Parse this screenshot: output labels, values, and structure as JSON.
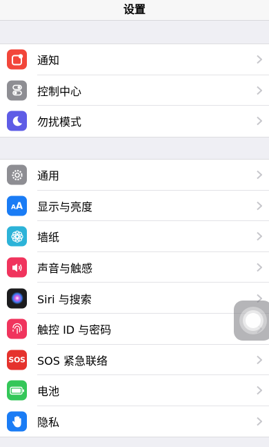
{
  "nav": {
    "title": "设置"
  },
  "group1": [
    {
      "label": "通知",
      "icon": "notifications-icon",
      "color": "#f2463a"
    },
    {
      "label": "控制中心",
      "icon": "control-center-icon",
      "color": "#8e8e93"
    },
    {
      "label": "勿扰模式",
      "icon": "moon-icon",
      "color": "#5e5ce6"
    }
  ],
  "group2": [
    {
      "label": "通用",
      "icon": "gear-icon",
      "color": "#8e8e93"
    },
    {
      "label": "显示与亮度",
      "icon": "display-aa-icon",
      "color": "#1a7cf5"
    },
    {
      "label": "墙纸",
      "icon": "wallpaper-flower-icon",
      "color": "#2cb3d8"
    },
    {
      "label": "声音与触感",
      "icon": "speaker-icon",
      "color": "#f0345d"
    },
    {
      "label": "Siri 与搜索",
      "icon": "siri-icon",
      "color": "#1c1c1e"
    },
    {
      "label": "触控 ID 与密码",
      "icon": "fingerprint-icon",
      "color": "#f0345d"
    },
    {
      "label": "SOS 紧急联络",
      "icon": "sos-icon",
      "color": "#e5322d",
      "icon_text": "SOS"
    },
    {
      "label": "电池",
      "icon": "battery-icon",
      "color": "#34c759"
    },
    {
      "label": "隐私",
      "icon": "hand-icon",
      "color": "#1a7cf5"
    }
  ]
}
